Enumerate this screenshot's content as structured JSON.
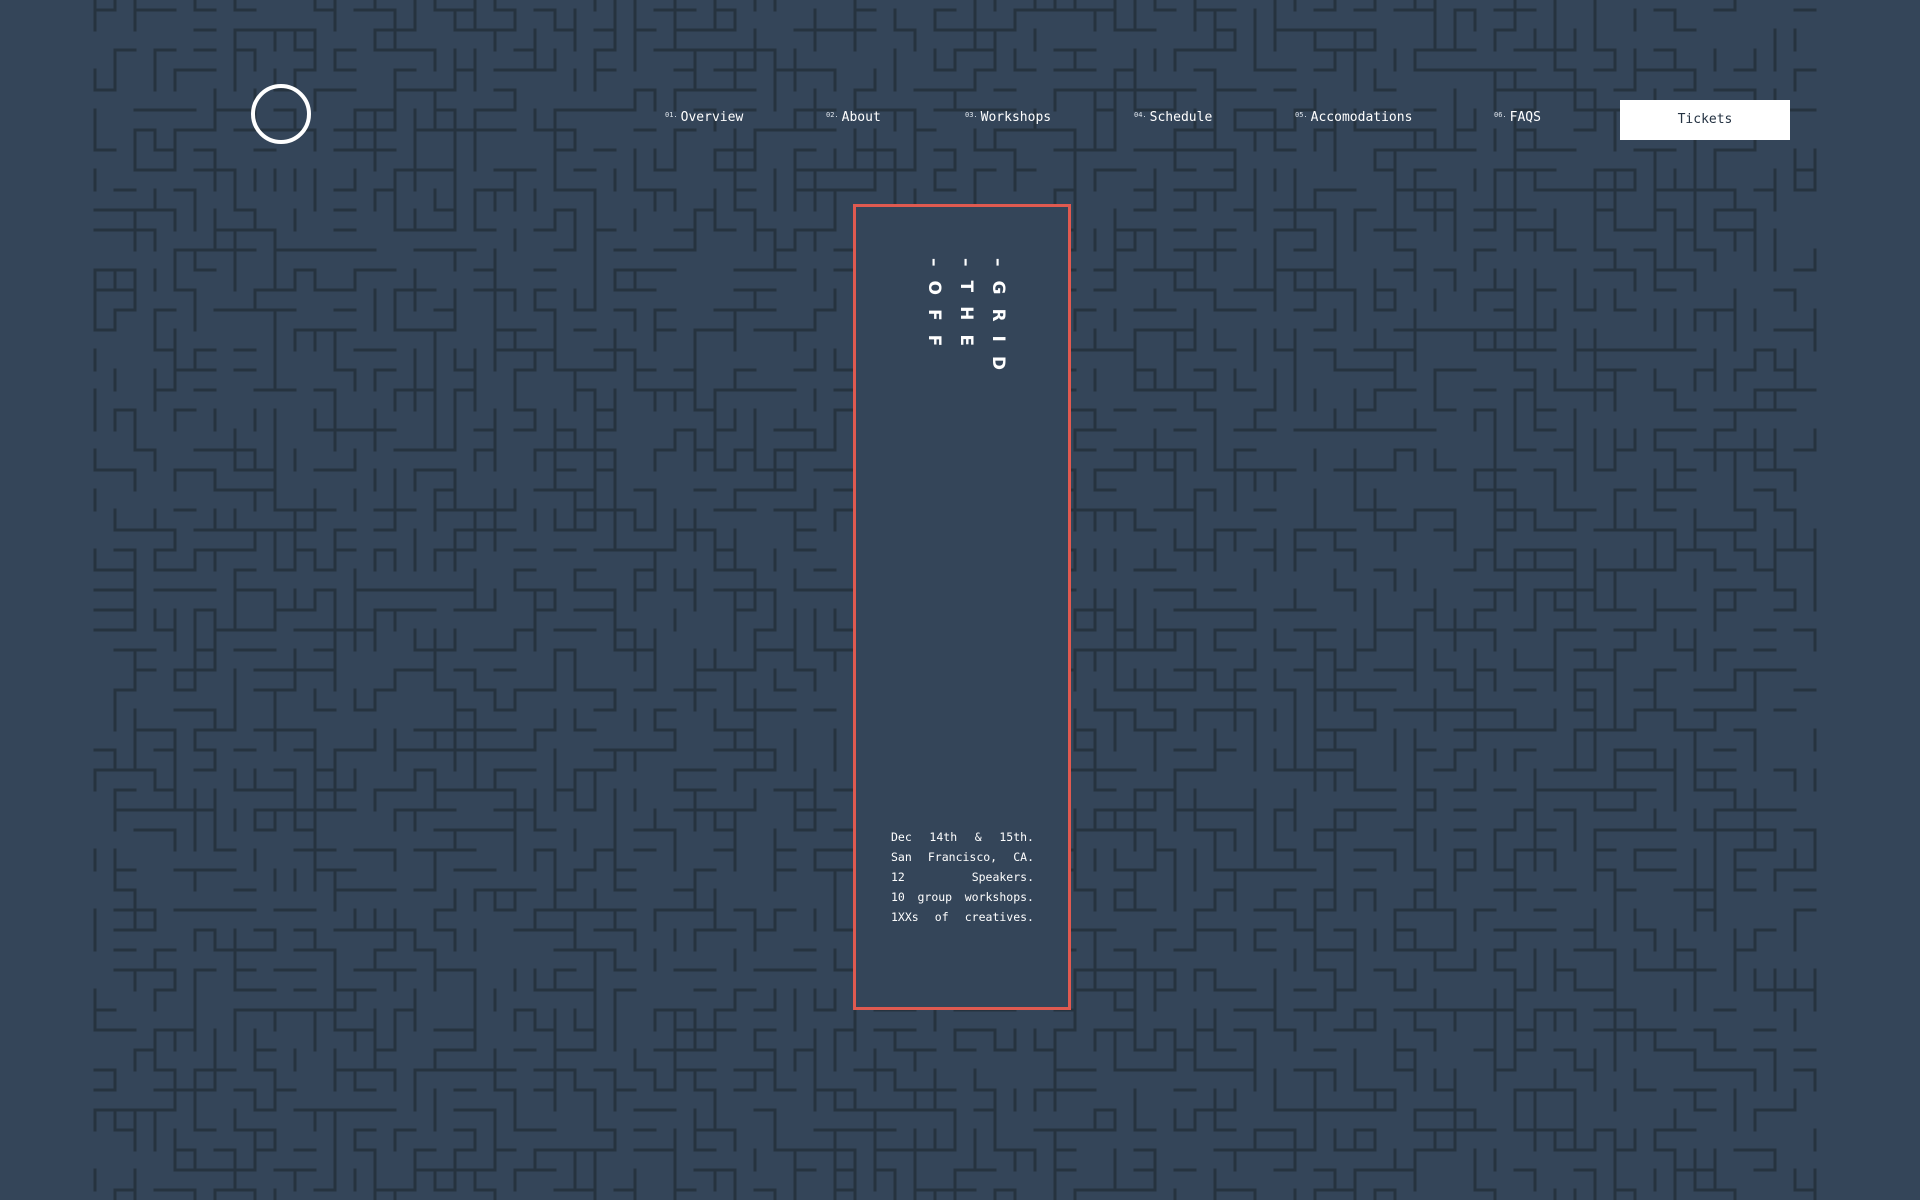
{
  "brand": {
    "logo_icon": "circle-ring-icon"
  },
  "nav": {
    "items": [
      {
        "num": "01.",
        "label": "Overview"
      },
      {
        "num": "02.",
        "label": "About"
      },
      {
        "num": "03.",
        "label": "Workshops"
      },
      {
        "num": "04.",
        "label": "Schedule"
      },
      {
        "num": "05.",
        "label": "Accomodations"
      },
      {
        "num": "06.",
        "label": "FAQS"
      }
    ],
    "tickets_label": "Tickets"
  },
  "hero": {
    "title_columns": [
      "OFF",
      "THE",
      "GRID"
    ],
    "details": [
      [
        "Dec",
        "14th",
        "&",
        "15th."
      ],
      [
        "San",
        "Francisco,",
        "CA."
      ],
      [
        "12",
        "Speakers."
      ],
      [
        "10",
        "group",
        "workshops."
      ],
      [
        "1XXs",
        "of",
        "creatives."
      ]
    ]
  },
  "colors": {
    "background": "#344559",
    "maze_lines": "#26333f",
    "accent": "#e05a50",
    "text": "#ffffff"
  }
}
